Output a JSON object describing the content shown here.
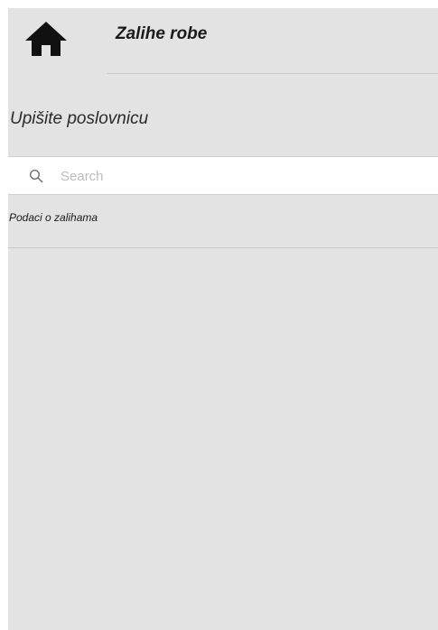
{
  "header": {
    "title": "Zalihe robe",
    "home_icon": "home-icon"
  },
  "page": {
    "title": "Upišite poslovnicu"
  },
  "search": {
    "placeholder": "Search",
    "value": "",
    "icon": "search-icon"
  },
  "section": {
    "label": "Podaci o zalihama"
  },
  "colors": {
    "background": "#e3e3e3",
    "search_background": "#ffffff",
    "divider": "#c8c8c8",
    "placeholder": "#b9bcc2"
  }
}
